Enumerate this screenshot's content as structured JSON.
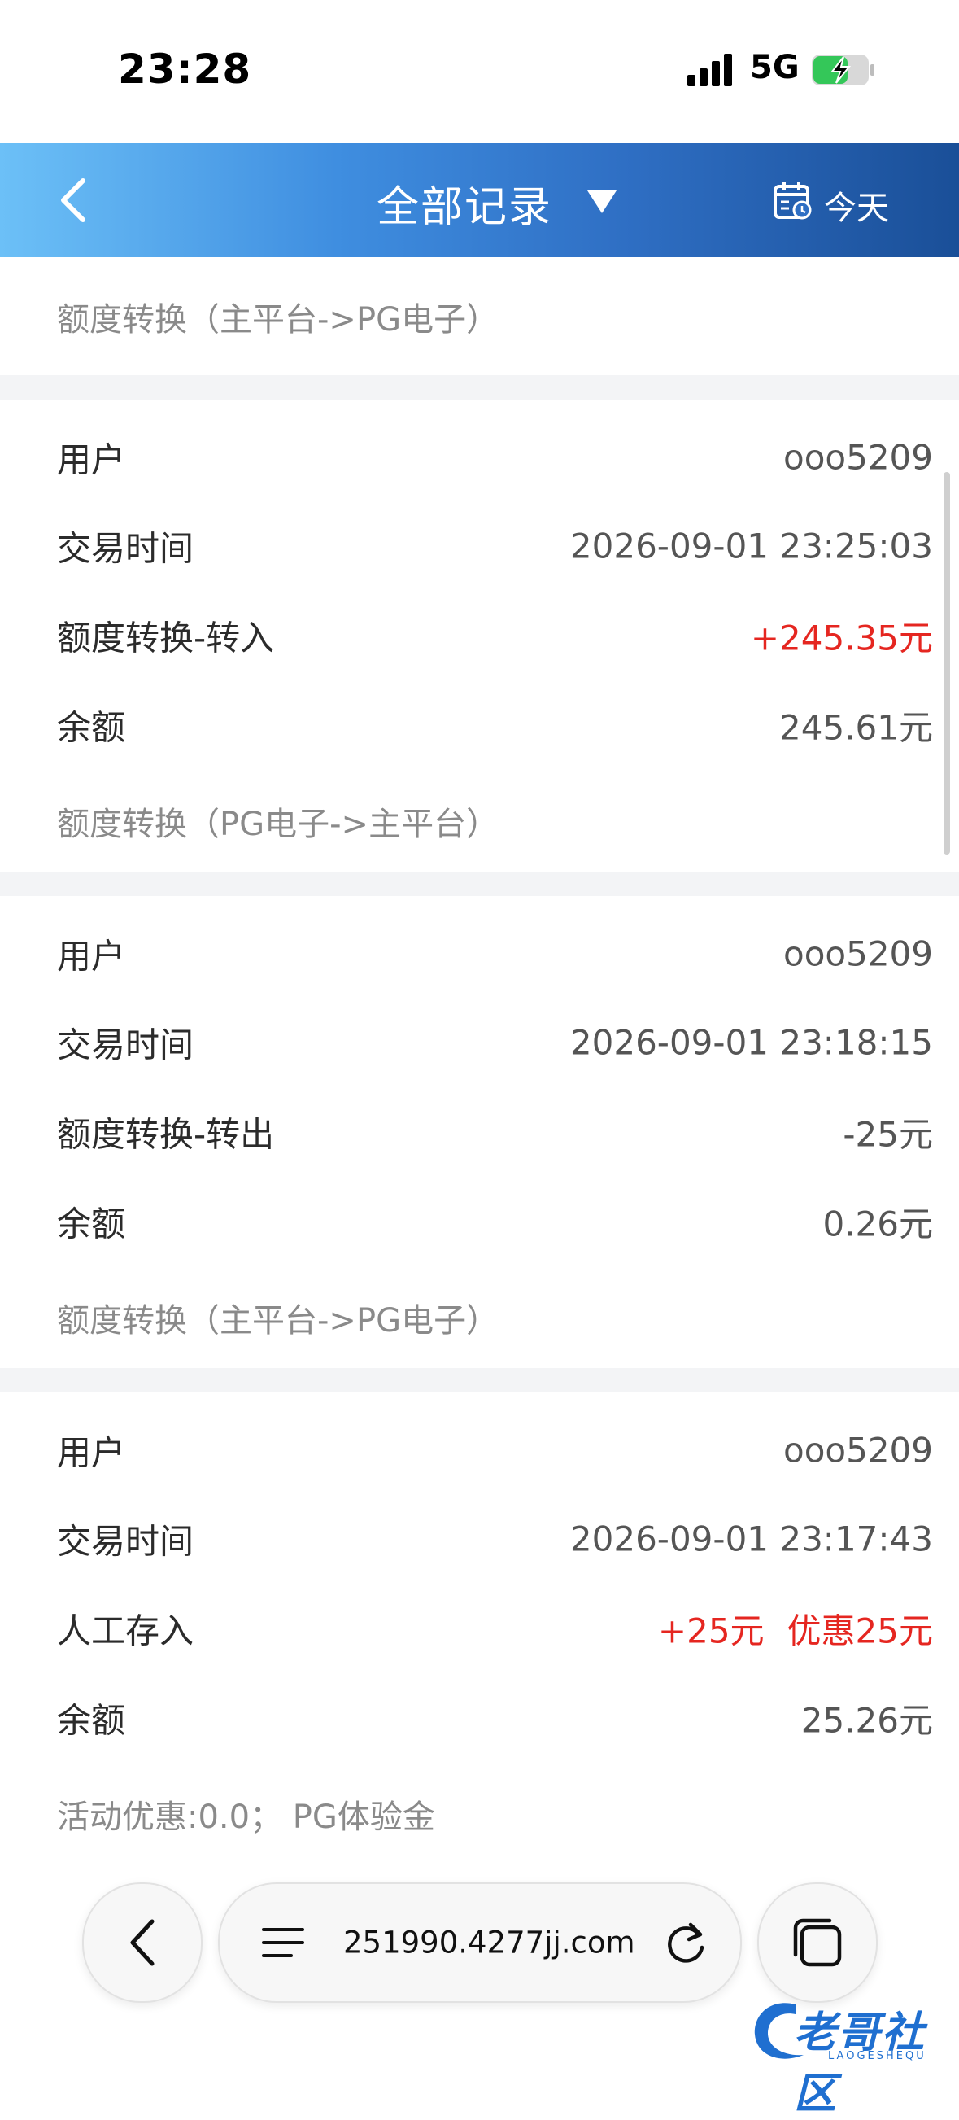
{
  "status_bar": {
    "time": "23:28",
    "network": "5G"
  },
  "nav": {
    "title": "全部记录",
    "date_filter": "今天"
  },
  "top_note": "额度转换（主平台->PG电子）",
  "records": [
    {
      "rows": [
        {
          "label": "用户",
          "value": "ooo5209"
        },
        {
          "label": "交易时间",
          "value": "2026-09-01 23:25:03"
        },
        {
          "label": "额度转换-转入",
          "value": "+245.35元",
          "highlight": true
        },
        {
          "label": "余额",
          "value": "245.61元"
        }
      ],
      "note": "额度转换（PG电子->主平台）"
    },
    {
      "rows": [
        {
          "label": "用户",
          "value": "ooo5209"
        },
        {
          "label": "交易时间",
          "value": "2026-09-01 23:18:15"
        },
        {
          "label": "额度转换-转出",
          "value": "-25元"
        },
        {
          "label": "余额",
          "value": "0.26元"
        }
      ],
      "note": "额度转换（主平台->PG电子）"
    },
    {
      "rows": [
        {
          "label": "用户",
          "value": "ooo5209"
        },
        {
          "label": "交易时间",
          "value": "2026-09-01 23:17:43"
        },
        {
          "label": "人工存入",
          "value": "+25元",
          "promo": "优惠25元",
          "highlight": true
        },
        {
          "label": "余额",
          "value": "25.26元"
        }
      ],
      "note": "活动优惠:0.0；  PG体验金"
    }
  ],
  "browser": {
    "url": "251990.4277jj.com"
  },
  "watermark": {
    "text": "老哥社区",
    "sub": "LAOGESHEQU"
  },
  "colors": {
    "accent_red": "#e52620",
    "nav_gradient_start": "#6cc0f7",
    "nav_gradient_end": "#1a4f98",
    "battery_green": "#34c759"
  }
}
